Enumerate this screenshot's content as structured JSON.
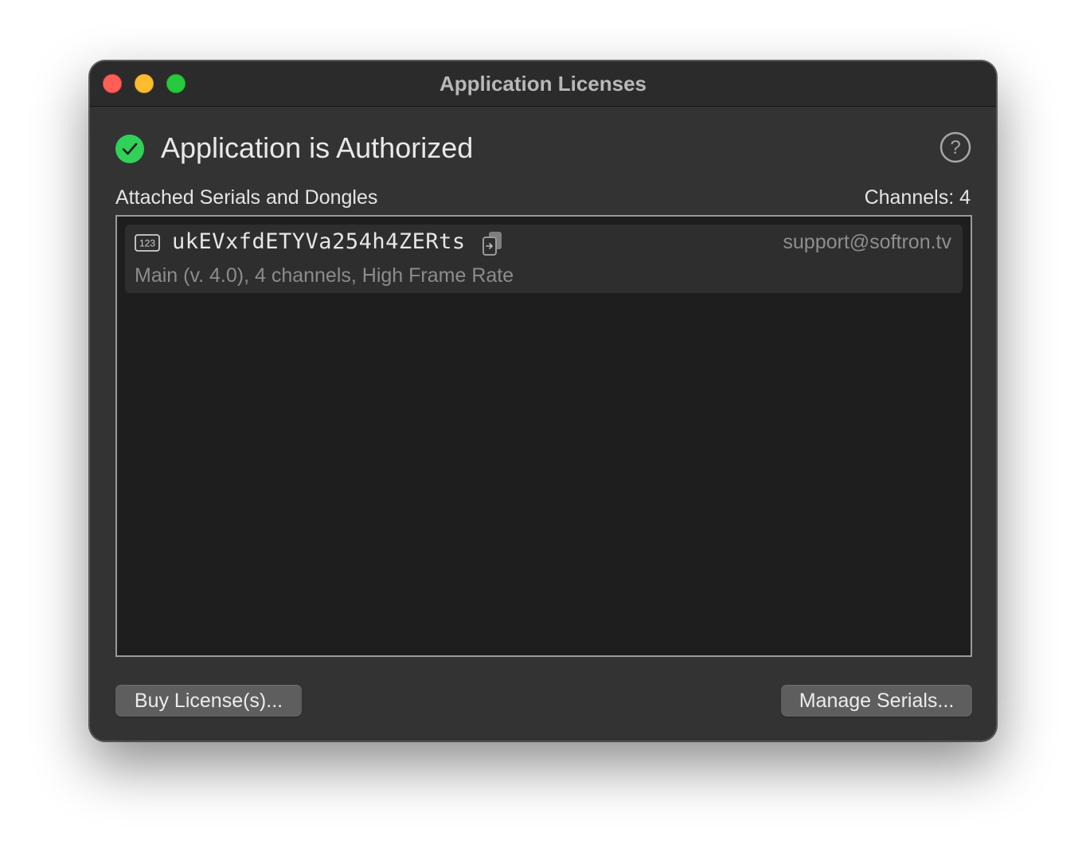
{
  "window": {
    "title": "Application Licenses"
  },
  "status": {
    "icon": "checkmark-circle-icon",
    "text": "Application is Authorized",
    "color": "#30d158"
  },
  "help": {
    "icon": "question-mark-circle-icon"
  },
  "serials_section": {
    "label": "Attached Serials and Dongles",
    "channels_text": "Channels: 4"
  },
  "serials": [
    {
      "icon": "serial-number-icon",
      "serial": "ukEVxfdETYVa254h4ZERts",
      "copy_icon": "copy-icon",
      "contact": "support@softron.tv",
      "details": "Main (v. 4.0), 4 channels, High Frame Rate"
    }
  ],
  "buttons": {
    "buy": "Buy License(s)...",
    "manage": "Manage Serials..."
  }
}
